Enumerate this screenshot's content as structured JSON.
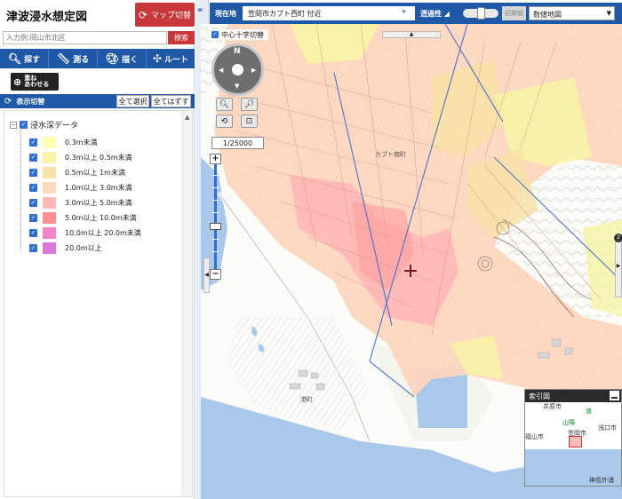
{
  "app": {
    "title": "津波浸水想定図",
    "map_switch_label": "マップ切替"
  },
  "search": {
    "placeholder": "入力例:岡山市北区",
    "button_label": "検索"
  },
  "toolbar": {
    "items": [
      {
        "label": "探す",
        "icon": "magnifier-icon"
      },
      {
        "label": "測る",
        "icon": "ruler-icon"
      },
      {
        "label": "描く",
        "icon": "palette-icon"
      },
      {
        "label": "ルート",
        "icon": "route-icon"
      }
    ]
  },
  "overlay_button": {
    "line1": "重ね",
    "line2": "あわせる"
  },
  "layer_panel": {
    "header_label": "表示切替",
    "select_all_label": "全て選択",
    "deselect_all_label": "全てはずす",
    "root_label": "浸水深データ",
    "items": [
      {
        "label": "0.3m未満",
        "color": "#ffffb3"
      },
      {
        "label": "0.3m以上 0.5m未満",
        "color": "#f7f5a6"
      },
      {
        "label": "0.5m以上 1m未満",
        "color": "#f8e1a6"
      },
      {
        "label": "1.0m以上 3.0m未満",
        "color": "#ffd8c0"
      },
      {
        "label": "3.0m以上 5.0m未満",
        "color": "#ffb7b7"
      },
      {
        "label": "5.0m以上 10.0m未満",
        "color": "#ff9191"
      },
      {
        "label": "10.0m以上 20.0m未満",
        "color": "#f285c9"
      },
      {
        "label": "20.0m以上",
        "color": "#dc7adc"
      }
    ]
  },
  "topbar": {
    "location_label": "現在地",
    "location_value": "笠岡市カブト西町 付近",
    "transparency_label": "透過性",
    "init_label": "初期値",
    "basemap_value": "数値地図"
  },
  "map": {
    "crosshair_toggle_label": "中心十字切替",
    "compass_label": "N",
    "scale_value": "1/25000",
    "town_label_1": "カブト南町",
    "town_label_2": "港町",
    "badge_count": "2"
  },
  "index_map": {
    "title": "索引図",
    "labels": {
      "city1": "井原市",
      "city2": "笠岡市",
      "city3": "浅口市",
      "city4": "福山市",
      "city5": "神島外浦",
      "road1": "道",
      "road2": "山陽"
    }
  }
}
